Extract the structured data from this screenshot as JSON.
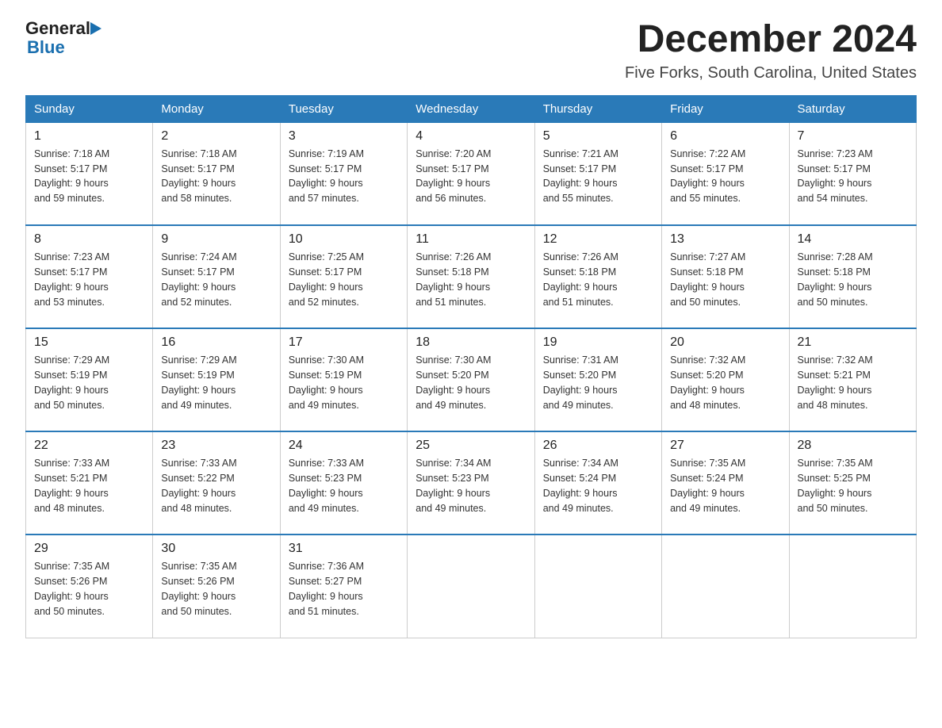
{
  "header": {
    "logo": {
      "general": "General",
      "blue": "Blue"
    },
    "title": "December 2024",
    "subtitle": "Five Forks, South Carolina, United States"
  },
  "days_of_week": [
    "Sunday",
    "Monday",
    "Tuesday",
    "Wednesday",
    "Thursday",
    "Friday",
    "Saturday"
  ],
  "weeks": [
    [
      {
        "day": "1",
        "sunrise": "7:18 AM",
        "sunset": "5:17 PM",
        "daylight": "9 hours and 59 minutes."
      },
      {
        "day": "2",
        "sunrise": "7:18 AM",
        "sunset": "5:17 PM",
        "daylight": "9 hours and 58 minutes."
      },
      {
        "day": "3",
        "sunrise": "7:19 AM",
        "sunset": "5:17 PM",
        "daylight": "9 hours and 57 minutes."
      },
      {
        "day": "4",
        "sunrise": "7:20 AM",
        "sunset": "5:17 PM",
        "daylight": "9 hours and 56 minutes."
      },
      {
        "day": "5",
        "sunrise": "7:21 AM",
        "sunset": "5:17 PM",
        "daylight": "9 hours and 55 minutes."
      },
      {
        "day": "6",
        "sunrise": "7:22 AM",
        "sunset": "5:17 PM",
        "daylight": "9 hours and 55 minutes."
      },
      {
        "day": "7",
        "sunrise": "7:23 AM",
        "sunset": "5:17 PM",
        "daylight": "9 hours and 54 minutes."
      }
    ],
    [
      {
        "day": "8",
        "sunrise": "7:23 AM",
        "sunset": "5:17 PM",
        "daylight": "9 hours and 53 minutes."
      },
      {
        "day": "9",
        "sunrise": "7:24 AM",
        "sunset": "5:17 PM",
        "daylight": "9 hours and 52 minutes."
      },
      {
        "day": "10",
        "sunrise": "7:25 AM",
        "sunset": "5:17 PM",
        "daylight": "9 hours and 52 minutes."
      },
      {
        "day": "11",
        "sunrise": "7:26 AM",
        "sunset": "5:18 PM",
        "daylight": "9 hours and 51 minutes."
      },
      {
        "day": "12",
        "sunrise": "7:26 AM",
        "sunset": "5:18 PM",
        "daylight": "9 hours and 51 minutes."
      },
      {
        "day": "13",
        "sunrise": "7:27 AM",
        "sunset": "5:18 PM",
        "daylight": "9 hours and 50 minutes."
      },
      {
        "day": "14",
        "sunrise": "7:28 AM",
        "sunset": "5:18 PM",
        "daylight": "9 hours and 50 minutes."
      }
    ],
    [
      {
        "day": "15",
        "sunrise": "7:29 AM",
        "sunset": "5:19 PM",
        "daylight": "9 hours and 50 minutes."
      },
      {
        "day": "16",
        "sunrise": "7:29 AM",
        "sunset": "5:19 PM",
        "daylight": "9 hours and 49 minutes."
      },
      {
        "day": "17",
        "sunrise": "7:30 AM",
        "sunset": "5:19 PM",
        "daylight": "9 hours and 49 minutes."
      },
      {
        "day": "18",
        "sunrise": "7:30 AM",
        "sunset": "5:20 PM",
        "daylight": "9 hours and 49 minutes."
      },
      {
        "day": "19",
        "sunrise": "7:31 AM",
        "sunset": "5:20 PM",
        "daylight": "9 hours and 49 minutes."
      },
      {
        "day": "20",
        "sunrise": "7:32 AM",
        "sunset": "5:20 PM",
        "daylight": "9 hours and 48 minutes."
      },
      {
        "day": "21",
        "sunrise": "7:32 AM",
        "sunset": "5:21 PM",
        "daylight": "9 hours and 48 minutes."
      }
    ],
    [
      {
        "day": "22",
        "sunrise": "7:33 AM",
        "sunset": "5:21 PM",
        "daylight": "9 hours and 48 minutes."
      },
      {
        "day": "23",
        "sunrise": "7:33 AM",
        "sunset": "5:22 PM",
        "daylight": "9 hours and 48 minutes."
      },
      {
        "day": "24",
        "sunrise": "7:33 AM",
        "sunset": "5:23 PM",
        "daylight": "9 hours and 49 minutes."
      },
      {
        "day": "25",
        "sunrise": "7:34 AM",
        "sunset": "5:23 PM",
        "daylight": "9 hours and 49 minutes."
      },
      {
        "day": "26",
        "sunrise": "7:34 AM",
        "sunset": "5:24 PM",
        "daylight": "9 hours and 49 minutes."
      },
      {
        "day": "27",
        "sunrise": "7:35 AM",
        "sunset": "5:24 PM",
        "daylight": "9 hours and 49 minutes."
      },
      {
        "day": "28",
        "sunrise": "7:35 AM",
        "sunset": "5:25 PM",
        "daylight": "9 hours and 50 minutes."
      }
    ],
    [
      {
        "day": "29",
        "sunrise": "7:35 AM",
        "sunset": "5:26 PM",
        "daylight": "9 hours and 50 minutes."
      },
      {
        "day": "30",
        "sunrise": "7:35 AM",
        "sunset": "5:26 PM",
        "daylight": "9 hours and 50 minutes."
      },
      {
        "day": "31",
        "sunrise": "7:36 AM",
        "sunset": "5:27 PM",
        "daylight": "9 hours and 51 minutes."
      },
      null,
      null,
      null,
      null
    ]
  ],
  "labels": {
    "sunrise": "Sunrise:",
    "sunset": "Sunset:",
    "daylight": "Daylight:"
  }
}
